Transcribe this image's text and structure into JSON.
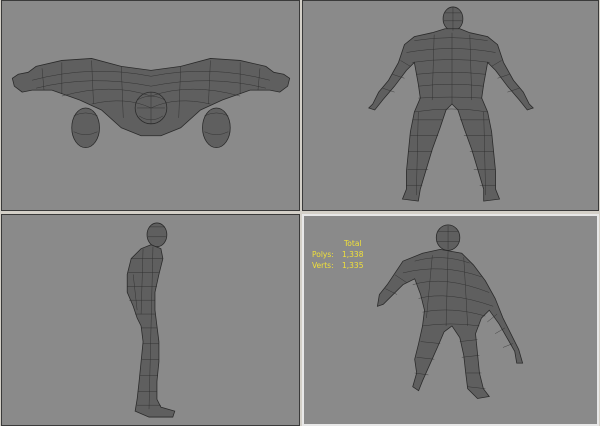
{
  "stats": {
    "header": "Total",
    "polys_label": "Polys:",
    "polys_value": "1,338",
    "verts_label": "Verts:",
    "verts_value": "1,335",
    "text_color": "#f0e03a"
  },
  "colors": {
    "viewport_bg": "#8a8a8a",
    "mesh_fill": "#5f5f5f",
    "wire": "#262626",
    "active_border": "#e8e8e8"
  }
}
